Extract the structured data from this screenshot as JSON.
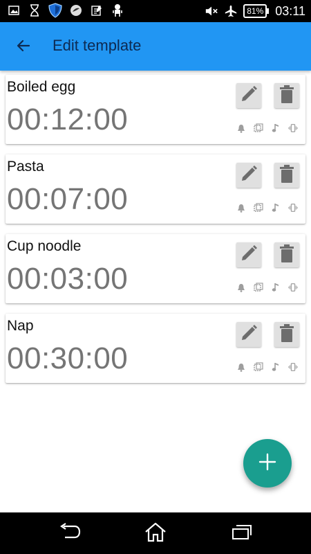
{
  "status_bar": {
    "left_icons": [
      "image-icon",
      "hourglass-icon",
      "shield-icon",
      "app-icon",
      "notes-icon",
      "android-icon"
    ],
    "right_icons": [
      "mute-icon",
      "airplane-icon"
    ],
    "battery_label": "81%",
    "time": "03:11"
  },
  "toolbar": {
    "title": "Edit template",
    "back_icon": "arrow-back-icon"
  },
  "templates": [
    {
      "name": "Boiled egg",
      "time": "00:12:00"
    },
    {
      "name": "Pasta",
      "time": "00:07:00"
    },
    {
      "name": "Cup noodle",
      "time": "00:03:00"
    },
    {
      "name": "Nap",
      "time": "00:30:00"
    }
  ],
  "card_icons": {
    "edit": "pencil-icon",
    "delete": "trash-icon",
    "options": [
      "bell-icon",
      "screen-icon",
      "music-note-icon",
      "vibrate-icon"
    ]
  },
  "fab_icon": "plus-icon",
  "nav_bar": [
    "back-icon",
    "home-icon",
    "recents-icon"
  ],
  "colors": {
    "toolbar": "#2196f3",
    "fab": "#1a9e8f",
    "time_text": "#757575"
  }
}
